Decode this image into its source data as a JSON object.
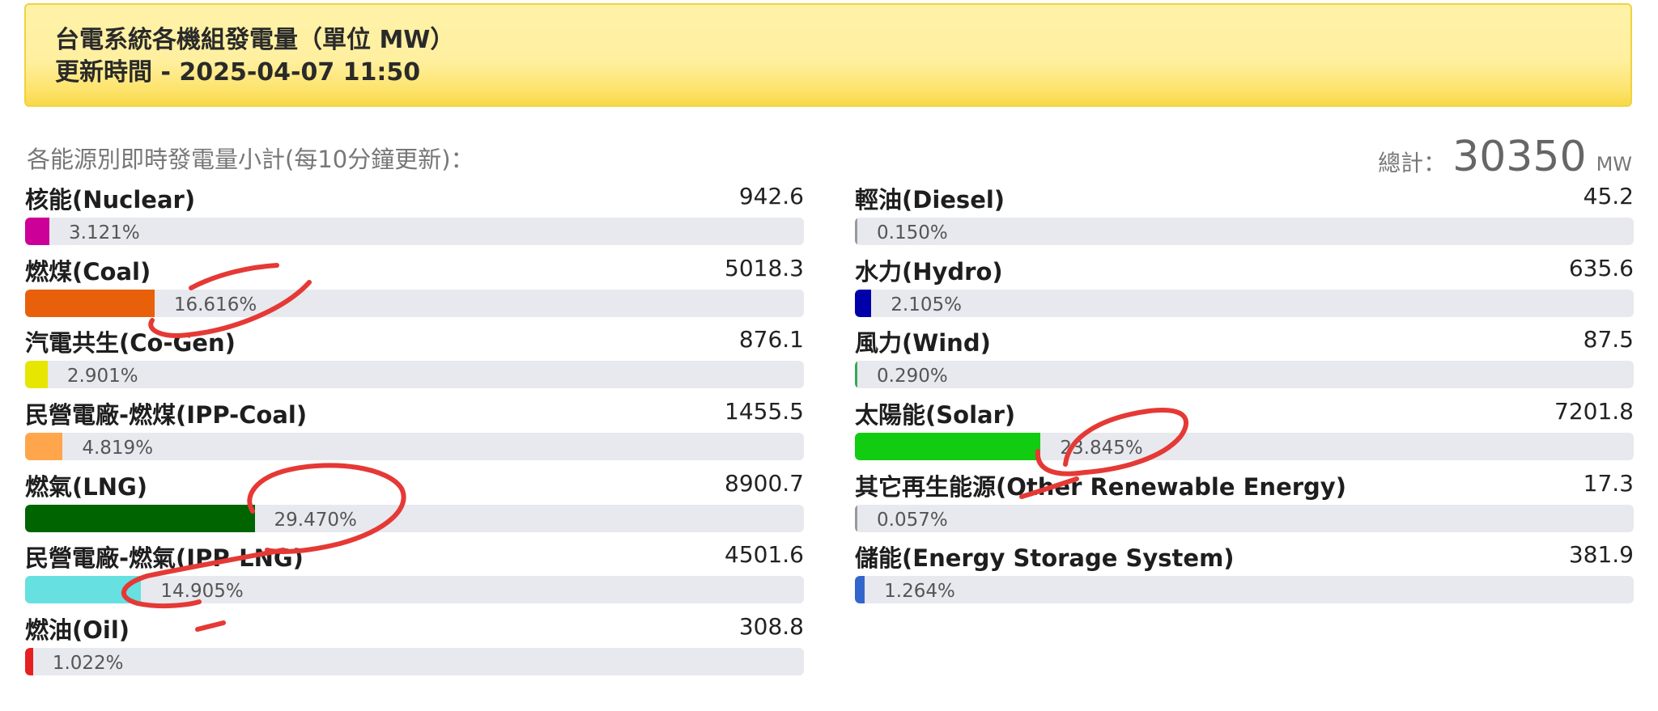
{
  "header": {
    "title": "台電系統各機組發電量（單位 MW）",
    "updated": "更新時間 - 2025-04-07 11:50"
  },
  "subtitle": "各能源別即時發電量小計(每10分鐘更新)：",
  "total": {
    "label": "總計：",
    "value": "30350",
    "unit": "MW"
  },
  "chart_data": {
    "type": "bar",
    "orientation": "horizontal",
    "title": "台電系統各機組發電量（單位 MW）",
    "xlim": [
      0,
      100
    ],
    "series": [
      {
        "name": "核能(Nuclear)",
        "value": "942.6",
        "percent": 3.121,
        "percent_label": "3.121%",
        "color": "#cc0099",
        "column": "left"
      },
      {
        "name": "燃煤(Coal)",
        "value": "5018.3",
        "percent": 16.616,
        "percent_label": "16.616%",
        "color": "#e8600a",
        "column": "left"
      },
      {
        "name": "汽電共生(Co-Gen)",
        "value": "876.1",
        "percent": 2.901,
        "percent_label": "2.901%",
        "color": "#e6e600",
        "column": "left"
      },
      {
        "name": "民營電廠-燃煤(IPP-Coal)",
        "value": "1455.5",
        "percent": 4.819,
        "percent_label": "4.819%",
        "color": "#ffa64d",
        "column": "left"
      },
      {
        "name": "燃氣(LNG)",
        "value": "8900.7",
        "percent": 29.47,
        "percent_label": "29.470%",
        "color": "#006400",
        "column": "left"
      },
      {
        "name": "民營電廠-燃氣(IPP-LNG)",
        "value": "4501.6",
        "percent": 14.905,
        "percent_label": "14.905%",
        "color": "#66e0e0",
        "column": "left"
      },
      {
        "name": "燃油(Oil)",
        "value": "308.8",
        "percent": 1.022,
        "percent_label": "1.022%",
        "color": "#e62020",
        "column": "left"
      },
      {
        "name": "輕油(Diesel)",
        "value": "45.2",
        "percent": 0.15,
        "percent_label": "0.150%",
        "color": "#999999",
        "column": "right"
      },
      {
        "name": "水力(Hydro)",
        "value": "635.6",
        "percent": 2.105,
        "percent_label": "2.105%",
        "color": "#0000aa",
        "column": "right"
      },
      {
        "name": "風力(Wind)",
        "value": "87.5",
        "percent": 0.29,
        "percent_label": "0.290%",
        "color": "#33aa55",
        "column": "right"
      },
      {
        "name": "太陽能(Solar)",
        "value": "7201.8",
        "percent": 23.845,
        "percent_label": "23.845%",
        "color": "#11cc11",
        "column": "right"
      },
      {
        "name": "其它再生能源(Other Renewable Energy)",
        "value": "17.3",
        "percent": 0.057,
        "percent_label": "0.057%",
        "color": "#999999",
        "column": "right"
      },
      {
        "name": "儲能(Energy Storage System)",
        "value": "381.9",
        "percent": 1.264,
        "percent_label": "1.264%",
        "color": "#3366cc",
        "column": "right"
      }
    ],
    "annotations": [
      "red hand-drawn circles around Coal, LNG, IPP-LNG and Solar percentages"
    ]
  }
}
